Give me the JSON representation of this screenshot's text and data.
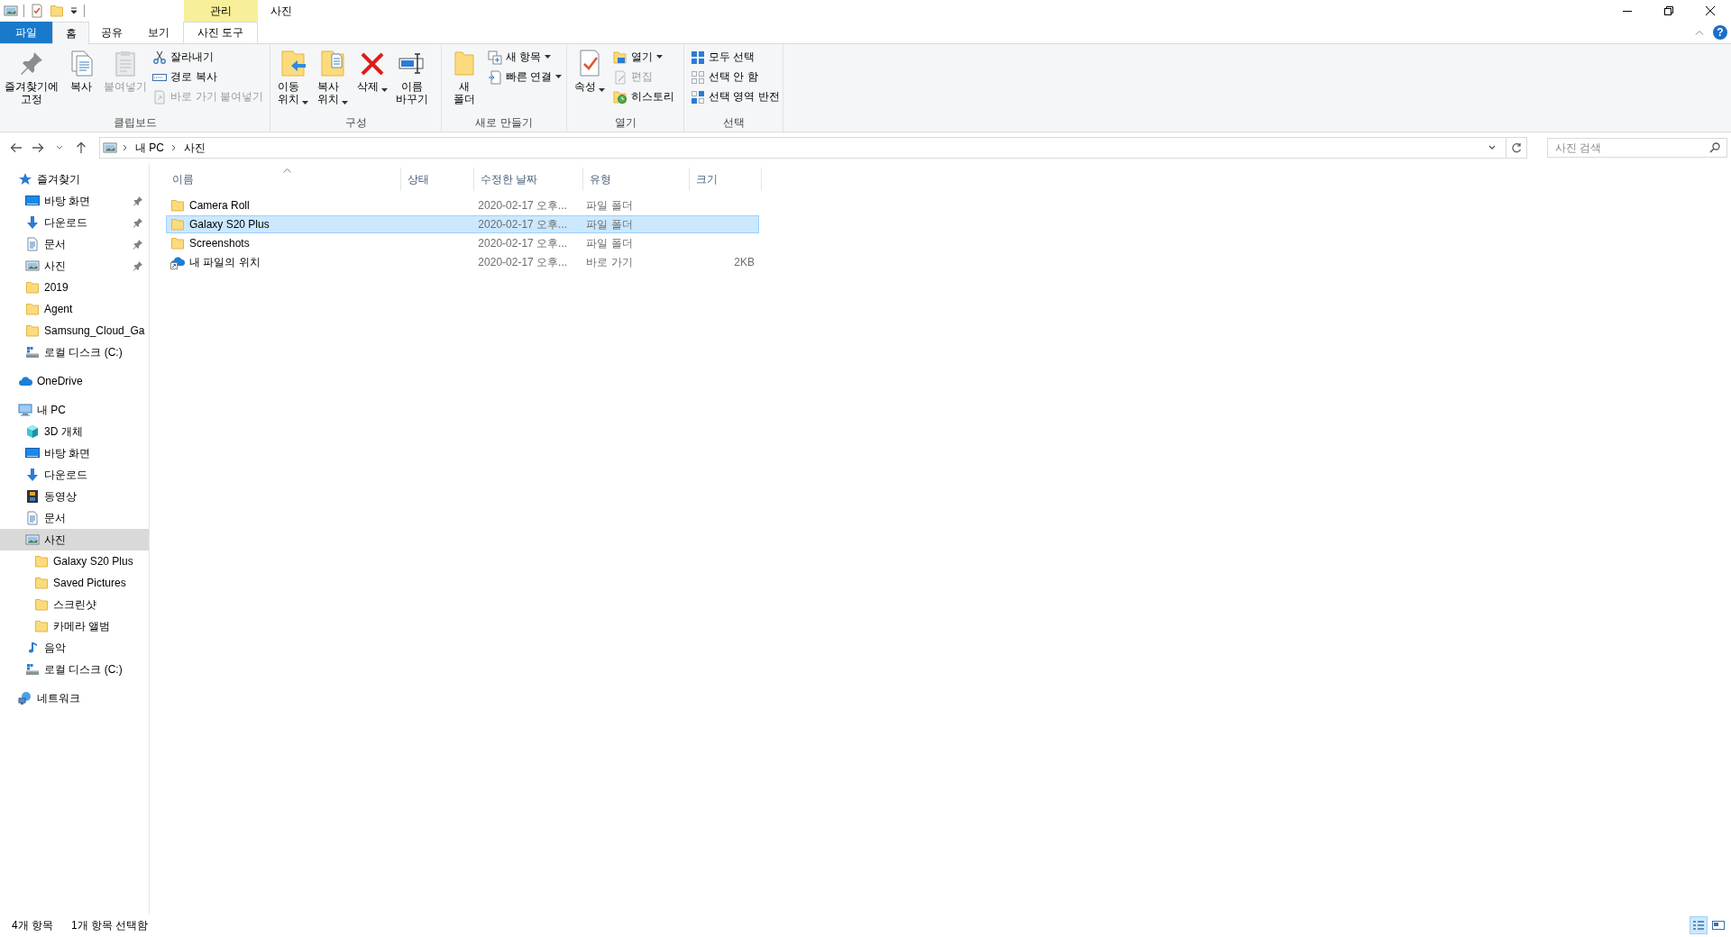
{
  "title_bar": {
    "context_label": "관리",
    "title": "사진"
  },
  "tabs": [
    {
      "label": "파일",
      "kind": "file",
      "selected": false
    },
    {
      "label": "홈",
      "kind": "normal",
      "selected": true
    },
    {
      "label": "공유",
      "kind": "normal",
      "selected": false
    },
    {
      "label": "보기",
      "kind": "normal",
      "selected": false
    },
    {
      "label": "사진 도구",
      "kind": "context",
      "selected": false
    }
  ],
  "help_label": "?",
  "ribbon": {
    "groups": [
      {
        "label": "클립보드",
        "items": [
          {
            "kind": "large",
            "label": "즐겨찾기에\n고정",
            "disabled": false,
            "dropdown": false
          },
          {
            "kind": "large",
            "label": "복사",
            "disabled": false,
            "dropdown": false
          },
          {
            "kind": "large",
            "label": "붙여넣기",
            "disabled": true,
            "dropdown": false
          },
          {
            "kind": "stack",
            "items": [
              {
                "label": "잘라내기",
                "disabled": false,
                "dropdown": false
              },
              {
                "label": "경로 복사",
                "disabled": false,
                "dropdown": false
              },
              {
                "label": "바로 가기 붙여넣기",
                "disabled": true,
                "dropdown": false
              }
            ]
          }
        ]
      },
      {
        "label": "구성",
        "items": [
          {
            "kind": "large",
            "label": "이동\n위치",
            "disabled": false,
            "dropdown": true
          },
          {
            "kind": "large",
            "label": "복사\n위치",
            "disabled": false,
            "dropdown": true
          },
          {
            "kind": "large",
            "label": "삭제",
            "disabled": false,
            "dropdown": true
          },
          {
            "kind": "large",
            "label": "이름\n바꾸기",
            "disabled": false,
            "dropdown": false
          }
        ]
      },
      {
        "label": "새로 만들기",
        "items": [
          {
            "kind": "large",
            "label": "새\n폴더",
            "disabled": false,
            "dropdown": false
          },
          {
            "kind": "stack",
            "items": [
              {
                "label": "새 항목",
                "disabled": false,
                "dropdown": true
              },
              {
                "label": "빠른 연결",
                "disabled": false,
                "dropdown": true
              }
            ]
          }
        ]
      },
      {
        "label": "열기",
        "items": [
          {
            "kind": "large",
            "label": "속성",
            "disabled": false,
            "dropdown": true
          },
          {
            "kind": "stack",
            "items": [
              {
                "label": "열기",
                "disabled": false,
                "dropdown": true
              },
              {
                "label": "편집",
                "disabled": true,
                "dropdown": false
              },
              {
                "label": "히스토리",
                "disabled": false,
                "dropdown": false
              }
            ]
          }
        ]
      },
      {
        "label": "선택",
        "items": [
          {
            "kind": "stack",
            "items": [
              {
                "label": "모두 선택",
                "disabled": false,
                "dropdown": false
              },
              {
                "label": "선택 안 함",
                "disabled": false,
                "dropdown": false
              },
              {
                "label": "선택 영역 반전",
                "disabled": false,
                "dropdown": false
              }
            ]
          }
        ]
      }
    ]
  },
  "address_bar": {
    "path": [
      "내 PC",
      "사진"
    ]
  },
  "search": {
    "placeholder": "사진 검색"
  },
  "navigation": [
    {
      "label": "즐겨찾기",
      "kind": "star",
      "selected": false,
      "children": [
        {
          "label": "바탕 화면",
          "kind": "desktop",
          "pinned": true,
          "selected": false
        },
        {
          "label": "다운로드",
          "kind": "download",
          "pinned": true,
          "selected": false
        },
        {
          "label": "문서",
          "kind": "document",
          "pinned": true,
          "selected": false
        },
        {
          "label": "사진",
          "kind": "pictures",
          "pinned": true,
          "selected": false
        },
        {
          "label": "2019",
          "kind": "folder",
          "pinned": false,
          "selected": false
        },
        {
          "label": "Agent",
          "kind": "folder",
          "pinned": false,
          "selected": false
        },
        {
          "label": "Samsung_Cloud_Ga",
          "kind": "folder",
          "pinned": false,
          "selected": false
        },
        {
          "label": "로컬 디스크 (C:)",
          "kind": "drive",
          "pinned": false,
          "selected": false
        }
      ]
    },
    {
      "label": "OneDrive",
      "kind": "cloud",
      "selected": false
    },
    {
      "label": "내 PC",
      "kind": "pc",
      "selected": false,
      "children": [
        {
          "label": "3D 개체",
          "kind": "cube",
          "selected": false
        },
        {
          "label": "바탕 화면",
          "kind": "desktop",
          "selected": false
        },
        {
          "label": "다운로드",
          "kind": "download",
          "selected": false
        },
        {
          "label": "동영상",
          "kind": "video",
          "selected": false
        },
        {
          "label": "문서",
          "kind": "document",
          "selected": false
        },
        {
          "label": "사진",
          "kind": "pictures",
          "selected": true,
          "children": [
            {
              "label": "Galaxy S20 Plus",
              "kind": "folder",
              "selected": false
            },
            {
              "label": "Saved Pictures",
              "kind": "folder",
              "selected": false
            },
            {
              "label": "스크린샷",
              "kind": "folder",
              "selected": false
            },
            {
              "label": "카메라 앨범",
              "kind": "folder",
              "selected": false
            }
          ]
        },
        {
          "label": "음악",
          "kind": "music",
          "selected": false
        },
        {
          "label": "로컬 디스크 (C:)",
          "kind": "drive",
          "selected": false
        }
      ]
    },
    {
      "label": "네트워크",
      "kind": "network",
      "selected": false
    }
  ],
  "file_list": {
    "columns": [
      {
        "label": "이름",
        "sorted": true
      },
      {
        "label": "상태",
        "sorted": false
      },
      {
        "label": "수정한 날짜",
        "sorted": false
      },
      {
        "label": "유형",
        "sorted": false
      },
      {
        "label": "크기",
        "sorted": false
      }
    ],
    "rows": [
      {
        "kind": "folder",
        "name": "Camera Roll",
        "date": "2020-02-17 오후...",
        "type": "파일 폴더",
        "selected": false
      },
      {
        "kind": "folder",
        "name": "Galaxy S20 Plus",
        "date": "2020-02-17 오후...",
        "type": "파일 폴더",
        "selected": true
      },
      {
        "kind": "folder",
        "name": "Screenshots",
        "date": "2020-02-17 오후...",
        "type": "파일 폴더",
        "selected": false
      },
      {
        "kind": "shortcut",
        "name": "내 파일의 위치",
        "date": "2020-02-17 오후...",
        "type": "바로 가기",
        "size": "2KB",
        "selected": false
      }
    ]
  },
  "status_bar": {
    "item_count": "4개 항목",
    "selection": "1개 항목 선택함",
    "views": [
      {
        "selected": true
      },
      {
        "selected": false
      }
    ]
  }
}
